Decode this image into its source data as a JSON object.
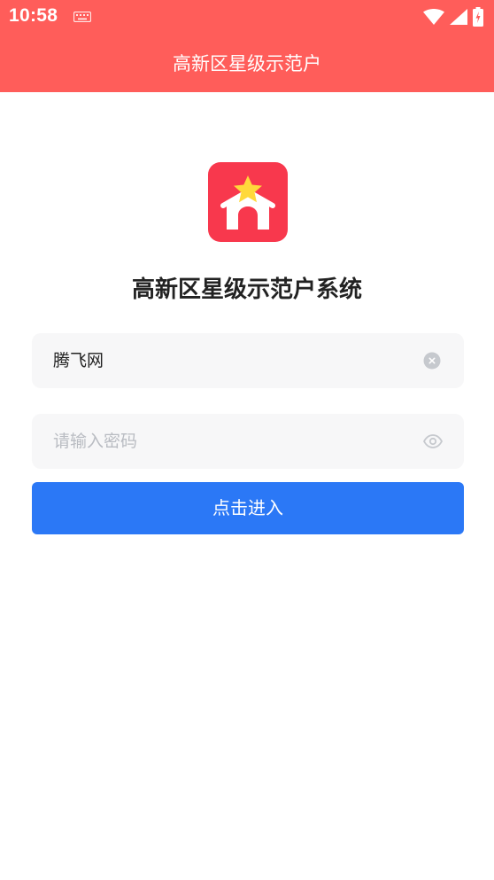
{
  "status_bar": {
    "time": "10:58",
    "icons": [
      "keyboard-icon",
      "wifi-icon",
      "signal-icon",
      "battery-charging-icon"
    ]
  },
  "header": {
    "title": "高新区星级示范户"
  },
  "logo": {
    "icon": "star-house-icon",
    "colors": {
      "background": "#f8384d",
      "star": "#ffd93b",
      "house": "#ffffff"
    }
  },
  "login": {
    "system_title": "高新区星级示范户系统",
    "username": {
      "value": "腾飞网",
      "clear_icon": "clear-icon"
    },
    "password": {
      "placeholder": "请输入密码",
      "toggle_icon": "eye-icon"
    },
    "submit_label": "点击进入"
  },
  "colors": {
    "header": "#ff5d5a",
    "primary_button": "#2b78f6",
    "input_background": "#f7f7f8",
    "placeholder": "#b9bcc2"
  }
}
